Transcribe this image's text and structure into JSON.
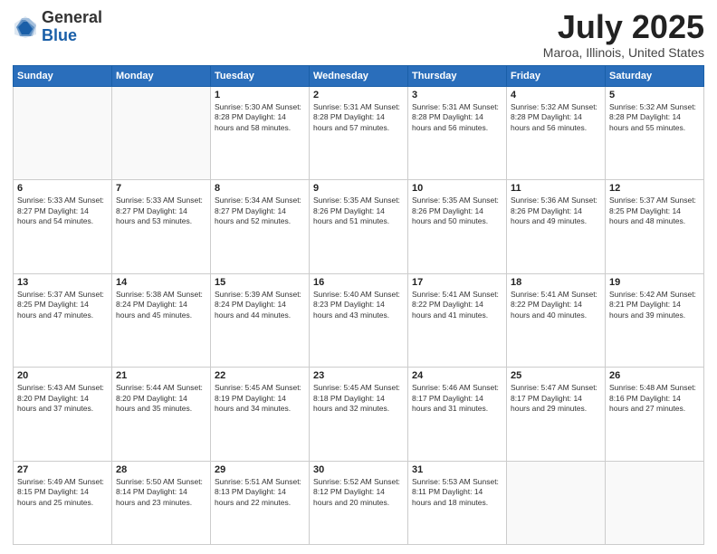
{
  "header": {
    "logo_general": "General",
    "logo_blue": "Blue",
    "month_title": "July 2025",
    "location": "Maroa, Illinois, United States"
  },
  "days_of_week": [
    "Sunday",
    "Monday",
    "Tuesday",
    "Wednesday",
    "Thursday",
    "Friday",
    "Saturday"
  ],
  "weeks": [
    [
      {
        "day": "",
        "detail": ""
      },
      {
        "day": "",
        "detail": ""
      },
      {
        "day": "1",
        "detail": "Sunrise: 5:30 AM\nSunset: 8:28 PM\nDaylight: 14 hours\nand 58 minutes."
      },
      {
        "day": "2",
        "detail": "Sunrise: 5:31 AM\nSunset: 8:28 PM\nDaylight: 14 hours\nand 57 minutes."
      },
      {
        "day": "3",
        "detail": "Sunrise: 5:31 AM\nSunset: 8:28 PM\nDaylight: 14 hours\nand 56 minutes."
      },
      {
        "day": "4",
        "detail": "Sunrise: 5:32 AM\nSunset: 8:28 PM\nDaylight: 14 hours\nand 56 minutes."
      },
      {
        "day": "5",
        "detail": "Sunrise: 5:32 AM\nSunset: 8:28 PM\nDaylight: 14 hours\nand 55 minutes."
      }
    ],
    [
      {
        "day": "6",
        "detail": "Sunrise: 5:33 AM\nSunset: 8:27 PM\nDaylight: 14 hours\nand 54 minutes."
      },
      {
        "day": "7",
        "detail": "Sunrise: 5:33 AM\nSunset: 8:27 PM\nDaylight: 14 hours\nand 53 minutes."
      },
      {
        "day": "8",
        "detail": "Sunrise: 5:34 AM\nSunset: 8:27 PM\nDaylight: 14 hours\nand 52 minutes."
      },
      {
        "day": "9",
        "detail": "Sunrise: 5:35 AM\nSunset: 8:26 PM\nDaylight: 14 hours\nand 51 minutes."
      },
      {
        "day": "10",
        "detail": "Sunrise: 5:35 AM\nSunset: 8:26 PM\nDaylight: 14 hours\nand 50 minutes."
      },
      {
        "day": "11",
        "detail": "Sunrise: 5:36 AM\nSunset: 8:26 PM\nDaylight: 14 hours\nand 49 minutes."
      },
      {
        "day": "12",
        "detail": "Sunrise: 5:37 AM\nSunset: 8:25 PM\nDaylight: 14 hours\nand 48 minutes."
      }
    ],
    [
      {
        "day": "13",
        "detail": "Sunrise: 5:37 AM\nSunset: 8:25 PM\nDaylight: 14 hours\nand 47 minutes."
      },
      {
        "day": "14",
        "detail": "Sunrise: 5:38 AM\nSunset: 8:24 PM\nDaylight: 14 hours\nand 45 minutes."
      },
      {
        "day": "15",
        "detail": "Sunrise: 5:39 AM\nSunset: 8:24 PM\nDaylight: 14 hours\nand 44 minutes."
      },
      {
        "day": "16",
        "detail": "Sunrise: 5:40 AM\nSunset: 8:23 PM\nDaylight: 14 hours\nand 43 minutes."
      },
      {
        "day": "17",
        "detail": "Sunrise: 5:41 AM\nSunset: 8:22 PM\nDaylight: 14 hours\nand 41 minutes."
      },
      {
        "day": "18",
        "detail": "Sunrise: 5:41 AM\nSunset: 8:22 PM\nDaylight: 14 hours\nand 40 minutes."
      },
      {
        "day": "19",
        "detail": "Sunrise: 5:42 AM\nSunset: 8:21 PM\nDaylight: 14 hours\nand 39 minutes."
      }
    ],
    [
      {
        "day": "20",
        "detail": "Sunrise: 5:43 AM\nSunset: 8:20 PM\nDaylight: 14 hours\nand 37 minutes."
      },
      {
        "day": "21",
        "detail": "Sunrise: 5:44 AM\nSunset: 8:20 PM\nDaylight: 14 hours\nand 35 minutes."
      },
      {
        "day": "22",
        "detail": "Sunrise: 5:45 AM\nSunset: 8:19 PM\nDaylight: 14 hours\nand 34 minutes."
      },
      {
        "day": "23",
        "detail": "Sunrise: 5:45 AM\nSunset: 8:18 PM\nDaylight: 14 hours\nand 32 minutes."
      },
      {
        "day": "24",
        "detail": "Sunrise: 5:46 AM\nSunset: 8:17 PM\nDaylight: 14 hours\nand 31 minutes."
      },
      {
        "day": "25",
        "detail": "Sunrise: 5:47 AM\nSunset: 8:17 PM\nDaylight: 14 hours\nand 29 minutes."
      },
      {
        "day": "26",
        "detail": "Sunrise: 5:48 AM\nSunset: 8:16 PM\nDaylight: 14 hours\nand 27 minutes."
      }
    ],
    [
      {
        "day": "27",
        "detail": "Sunrise: 5:49 AM\nSunset: 8:15 PM\nDaylight: 14 hours\nand 25 minutes."
      },
      {
        "day": "28",
        "detail": "Sunrise: 5:50 AM\nSunset: 8:14 PM\nDaylight: 14 hours\nand 23 minutes."
      },
      {
        "day": "29",
        "detail": "Sunrise: 5:51 AM\nSunset: 8:13 PM\nDaylight: 14 hours\nand 22 minutes."
      },
      {
        "day": "30",
        "detail": "Sunrise: 5:52 AM\nSunset: 8:12 PM\nDaylight: 14 hours\nand 20 minutes."
      },
      {
        "day": "31",
        "detail": "Sunrise: 5:53 AM\nSunset: 8:11 PM\nDaylight: 14 hours\nand 18 minutes."
      },
      {
        "day": "",
        "detail": ""
      },
      {
        "day": "",
        "detail": ""
      }
    ]
  ]
}
